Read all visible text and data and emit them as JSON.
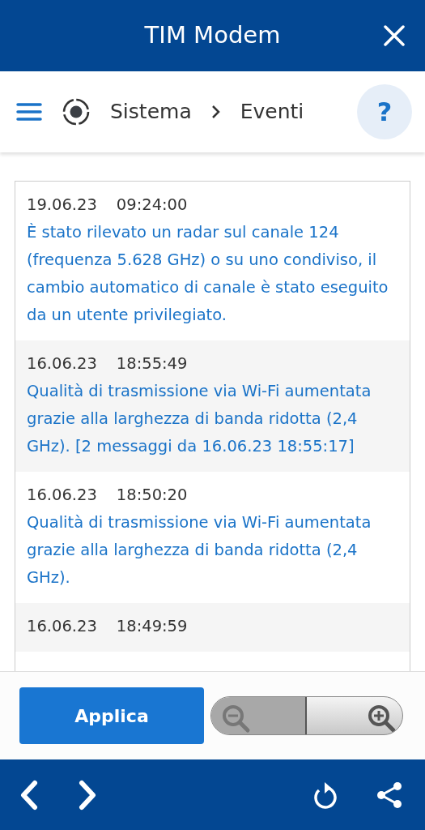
{
  "window": {
    "title": "TIM Modem"
  },
  "breadcrumb": [
    "Sistema",
    "Eventi"
  ],
  "help_button": "?",
  "events": [
    {
      "date": "19.06.23",
      "time": "09:24:00",
      "message": "È stato rilevato un radar sul canale 124 (frequenza 5.628 GHz) o su uno condiviso, il cambio automatico di canale è stato eseguito da un utente privilegiato."
    },
    {
      "date": "16.06.23",
      "time": "18:55:49",
      "message": "Qualità di trasmissione via Wi-Fi aumentata grazie alla larghezza di banda ridotta (2,4 GHz). [2 messaggi da 16.06.23 18:55:17]"
    },
    {
      "date": "16.06.23",
      "time": "18:50:20",
      "message": "Qualità di trasmissione via Wi-Fi aumentata grazie alla larghezza di banda ridotta (2,4 GHz)."
    },
    {
      "date": "16.06.23",
      "time": "18:49:59"
    }
  ],
  "apply_button": "Applica",
  "zoom": {
    "level": 0.5
  }
}
